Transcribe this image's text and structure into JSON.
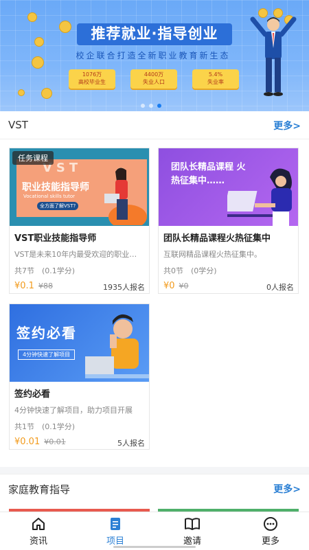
{
  "banner": {
    "title": "推荐就业·指导创业",
    "subtitle": "校企联合打造全新职业教育新生态",
    "stats": [
      {
        "num": "1076万",
        "label": "高校毕业生"
      },
      {
        "num": "4400万",
        "label": "失业人口"
      },
      {
        "num": "5.4%",
        "label": "失业率"
      }
    ],
    "active_dot": 2
  },
  "sections": [
    {
      "title": "VST",
      "more": "更多>"
    },
    {
      "title": "家庭教育指导",
      "more": "更多>"
    }
  ],
  "cards": [
    {
      "tag": "任务课程",
      "thumb_title": "职业技能指导师",
      "thumb_sub": "Vocational skills tutor",
      "thumb_btn": "全方面了解VST?",
      "thumb_logo": "VST",
      "title": "VST职业技能指导师",
      "desc": "VST是未来10年内最受欢迎的职业…",
      "meta": "共7节　(0.1学分)",
      "price": "¥0.1",
      "orig": "¥88",
      "enroll": "1935人报名"
    },
    {
      "thumb_title": "团队长精品课程 火热征集中……",
      "title": "团队长精品课程火热征集中",
      "desc": "互联网精品课程火热征集中。",
      "meta": "共0节　(0学分)",
      "price": "¥0",
      "orig": "¥0",
      "enroll": "0人报名"
    },
    {
      "thumb_title": "签约必看",
      "thumb_btn": "4分钟快速了解项目",
      "title": "签约必看",
      "desc": "4分钟快速了解项目，助力项目开展",
      "meta": "共1节　(0.1学分)",
      "price": "¥0.01",
      "orig": "¥0.01",
      "enroll": "5人报名"
    }
  ],
  "tabs": [
    {
      "label": "资讯",
      "icon": "home-icon"
    },
    {
      "label": "项目",
      "icon": "document-icon"
    },
    {
      "label": "邀请",
      "icon": "book-icon"
    },
    {
      "label": "更多",
      "icon": "more-icon"
    }
  ],
  "active_tab": 1,
  "colors": {
    "accent": "#2a7fd4",
    "price": "#f29b1d"
  }
}
